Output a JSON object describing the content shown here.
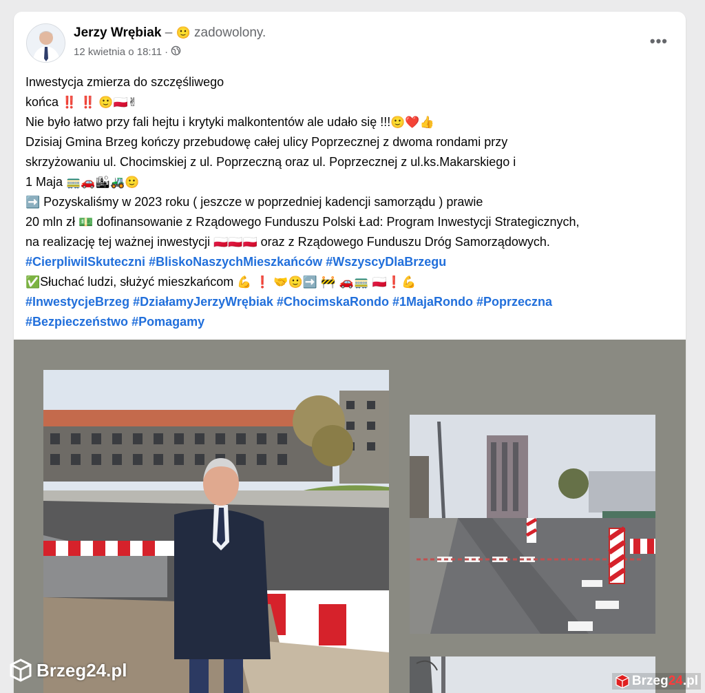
{
  "post": {
    "author": "Jerzy Wrębiak",
    "feeling_prefix": "– ",
    "feeling_emoji": "🙂",
    "feeling": " zadowolony.",
    "date": "12 kwietnia o 18:11",
    "separator": "·",
    "privacy_icon": "globe-icon",
    "more_label": "•••"
  },
  "text": {
    "l1": "Inwestycja zmierza do szczęśliwego",
    "l2a": " końca ",
    "l2_marks": "‼️ ‼️",
    "l2_emoji": "🙂🇵🇱✌",
    "l3": "Nie było łatwo przy fali hejtu i krytyki malkontentów ale udało się !!!",
    "l3_emoji": "🙂❤️👍",
    "l4": "Dzisiaj Gmina Brzeg kończy przebudowę całej ulicy Poprzecznej z dwoma rondami przy",
    "l5": "skrzyżowaniu ul. Chocimskiej z ul. Poprzeczną oraz ul. Poprzecznej z ul.ks.Makarskiego i",
    "l6": "1 Maja  ",
    "l6_emoji": "🚃🚗🏙🚜🙂",
    "l7_arrow": "➡️",
    "l7": " Pozyskaliśmy w 2023 roku ( jeszcze w poprzedniej kadencji samorządu ) prawie",
    "l8a": "20 mln zł ",
    "l8_emoji": "💵",
    "l8b": " dofinansowanie z Rządowego Funduszu Polski Ład: Program Inwestycji Strategicznych,",
    "l9a": "na realizację tej ważnej inwestycji ",
    "l9_emoji": "🇵🇱🇵🇱🇵🇱",
    "l9b": " oraz z  Rządowego Funduszu Dróg Samorządowych.",
    "tags1": [
      " #CierpliwiISkuteczni",
      "#BliskoNaszychMieszkańców",
      "#WszyscyDlaBrzegu"
    ],
    "l11_check": "✅",
    "l11": "Słuchać ludzi,  służyć mieszkańcom ",
    "l11_emoji": "💪  ❗ 🤝🙂➡️  🚧  🚗🚃  🇵🇱❗💪",
    "tags2": [
      "#InwestycjeBrzeg",
      "#DziałamyJerzyWrębiak",
      "#ChocimskaRondo",
      "#1MajaRondo",
      "#Poprzeczna"
    ],
    "tags3": [
      "#Bezpieczeństwo",
      "#Pomagamy"
    ]
  },
  "watermark": {
    "left_main": "Brzeg24",
    "left_suffix": ".pl",
    "right_main": "Brzeg",
    "right_accent": "24",
    "right_suffix": ".pl"
  }
}
